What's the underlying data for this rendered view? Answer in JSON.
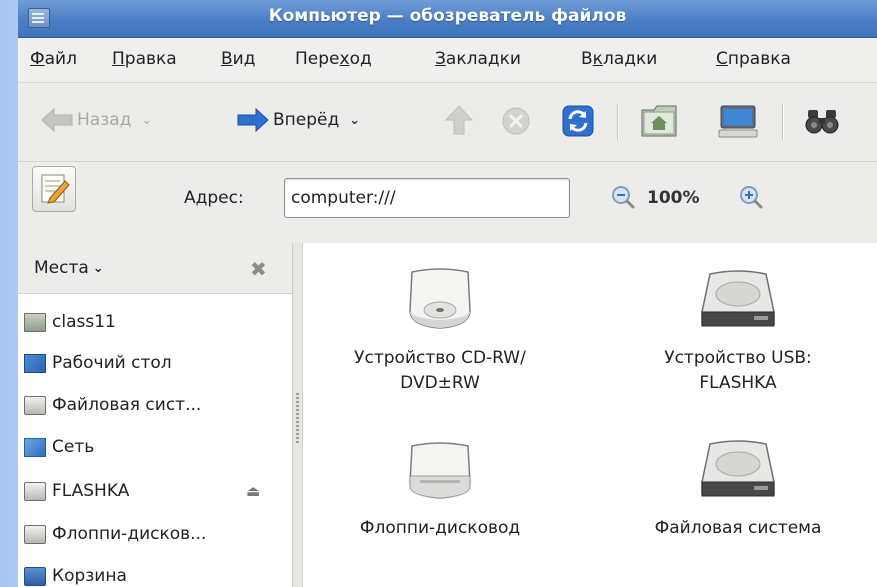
{
  "window": {
    "title": "Компьютер — обозреватель файлов"
  },
  "menubar": {
    "items": [
      {
        "pre": "",
        "u": "Ф",
        "post": "айл"
      },
      {
        "pre": "",
        "u": "П",
        "post": "равка"
      },
      {
        "pre": "",
        "u": "В",
        "post": "ид"
      },
      {
        "pre": "Пере",
        "u": "х",
        "post": "од"
      },
      {
        "pre": "",
        "u": "З",
        "post": "акладки"
      },
      {
        "pre": "В",
        "u": "к",
        "post": "ладки"
      },
      {
        "pre": "",
        "u": "С",
        "post": "правка"
      }
    ]
  },
  "toolbar": {
    "back_label": "Назад",
    "forward_label": "Вперёд",
    "icons": [
      "back-arrow-icon",
      "forward-arrow-icon",
      "up-arrow-icon",
      "stop-icon",
      "reload-icon",
      "home-icon",
      "computer-icon",
      "search-binoculars-icon"
    ]
  },
  "location": {
    "label": "Адрес:",
    "value": "computer:///",
    "zoom": "100%"
  },
  "sidebar": {
    "title": "Места",
    "items": [
      {
        "label": "class11",
        "icon": "folder-icon"
      },
      {
        "label": "Рабочий стол",
        "icon": "desktop-icon"
      },
      {
        "label": "Файловая сист...",
        "icon": "drive-icon"
      },
      {
        "label": "Сеть",
        "icon": "network-icon"
      },
      {
        "label": "FLASHKA",
        "icon": "usb-drive-icon",
        "ejectable": true
      },
      {
        "label": "Флоппи-дисков...",
        "icon": "floppy-icon"
      },
      {
        "label": "Корзина",
        "icon": "trash-icon"
      }
    ]
  },
  "devices": [
    {
      "line1": "Устройство CD-RW/",
      "line2": "DVD±RW",
      "icon": "optical-drive-icon"
    },
    {
      "line1": "Устройство USB:",
      "line2": "FLASHKA",
      "icon": "hard-drive-icon"
    },
    {
      "line1": "Флоппи-дисковод",
      "line2": "",
      "icon": "floppy-drive-icon"
    },
    {
      "line1": "Файловая система",
      "line2": "",
      "icon": "hard-drive-icon"
    }
  ],
  "colors": {
    "titlebar": "#4a7fc6",
    "accent_blue": "#2f6fd0"
  }
}
